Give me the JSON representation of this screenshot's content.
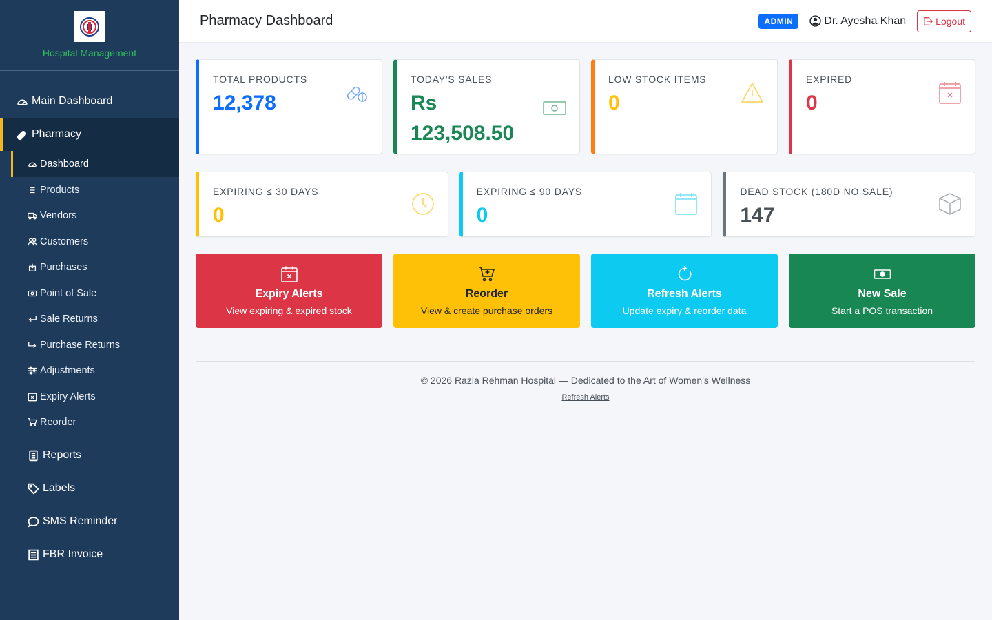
{
  "sidebar": {
    "brand_name": "Hospital Management",
    "main_dashboard": "Main Dashboard",
    "pharmacy": "Pharmacy",
    "sub_items": [
      "Dashboard",
      "Products",
      "Vendors",
      "Customers",
      "Purchases",
      "Point of Sale",
      "Sale Returns",
      "Purchase Returns",
      "Adjustments",
      "Expiry Alerts",
      "Reorder"
    ],
    "lower_items": [
      "Reports",
      "Labels",
      "SMS Reminder",
      "FBR Invoice"
    ]
  },
  "header": {
    "title": "Pharmacy Dashboard",
    "badge": "ADMIN",
    "user": "Dr. Ayesha Khan",
    "logout": "Logout"
  },
  "stats_row1": [
    {
      "label": "TOTAL PRODUCTS",
      "value": "12,378",
      "color": "#0d6efd",
      "icon": "pills-icon"
    },
    {
      "label": "TODAY'S SALES",
      "value": "Rs 123,508.50",
      "color": "#198754",
      "icon": "cash-icon"
    },
    {
      "label": "LOW STOCK ITEMS",
      "value": "0",
      "color": "#fbbf24",
      "icon": "warning-icon"
    },
    {
      "label": "EXPIRED",
      "value": "0",
      "color": "#dc3545",
      "icon": "calendar-x-icon"
    }
  ],
  "stats_row2": [
    {
      "label": "EXPIRING ≤ 30 DAYS",
      "value": "0",
      "color": "#ffc107",
      "icon": "clock-icon"
    },
    {
      "label": "EXPIRING ≤ 90 DAYS",
      "value": "0",
      "color": "#0dcaf0",
      "icon": "calendar-icon"
    },
    {
      "label": "DEAD STOCK (180D NO SALE)",
      "value": "147",
      "color": "#6c757d",
      "icon": "box-icon"
    }
  ],
  "actions": [
    {
      "title": "Expiry Alerts",
      "subtitle": "View expiring & expired stock",
      "bg": "#dc3545",
      "fg": "#ffffff"
    },
    {
      "title": "Reorder",
      "subtitle": "View & create purchase orders",
      "bg": "#ffc107",
      "fg": "#212529"
    },
    {
      "title": "Refresh Alerts",
      "subtitle": "Update expiry & reorder data",
      "bg": "#0dcaf0",
      "fg": "#ffffff"
    },
    {
      "title": "New Sale",
      "subtitle": "Start a POS transaction",
      "bg": "#198754",
      "fg": "#ffffff"
    }
  ],
  "footer": {
    "text": "© 2026 Razia Rehman Hospital — Dedicated to the Art of Women's Wellness",
    "link": "Refresh Alerts"
  }
}
